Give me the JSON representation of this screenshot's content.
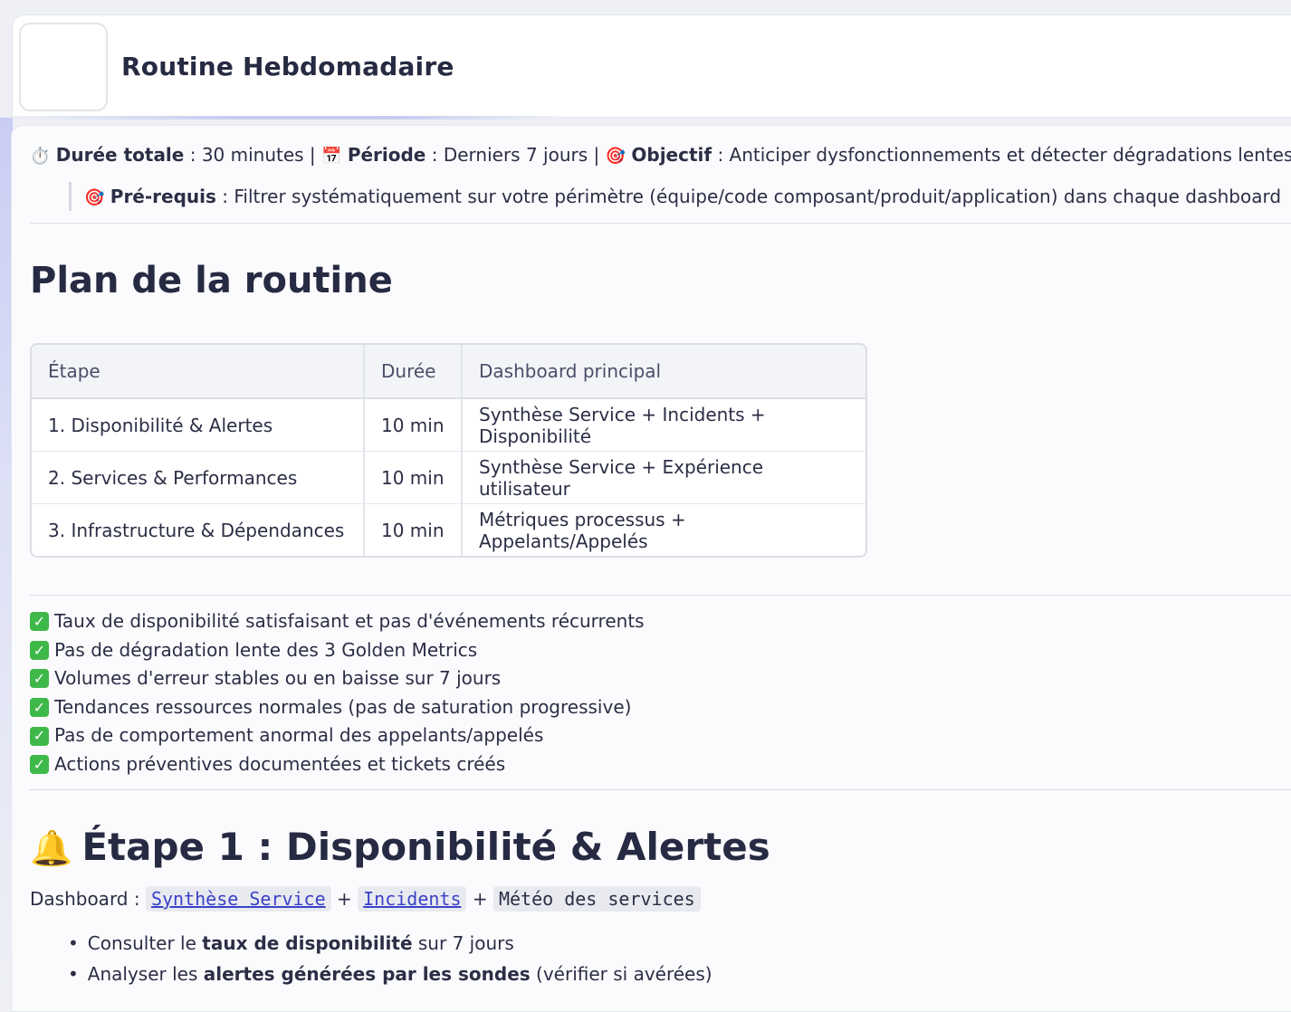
{
  "app": {
    "title": "Routine Hebdomadaire"
  },
  "meta": {
    "duration_label": "Durée totale",
    "duration_value": " : 30 minutes | ",
    "period_label": "Période",
    "period_value": " : Derniers 7 jours | ",
    "objective_label": "Objectif",
    "objective_value": " : Anticiper dysfonctionnements et détecter dégradations lentes",
    "icons": [
      "stopwatch-icon",
      "calendar-icon",
      "target-icon"
    ]
  },
  "prereq": {
    "label": "Pré-requis",
    "value": " : Filtrer systématiquement sur votre périmètre (équipe/code composant/produit/application) dans chaque dashboard"
  },
  "plan": {
    "heading": "Plan de la routine",
    "columns": [
      "Étape",
      "Durée",
      "Dashboard principal"
    ],
    "rows": [
      [
        "1. Disponibilité & Alertes",
        "10 min",
        "Synthèse Service + Incidents + Disponibilité"
      ],
      [
        "2. Services & Performances",
        "10 min",
        "Synthèse Service + Expérience utilisateur"
      ],
      [
        "3. Infrastructure & Dépendances",
        "10 min",
        "Métriques processus + Appelants/Appelés"
      ]
    ]
  },
  "checklist": [
    "Taux de disponibilité satisfaisant et pas d'événements récurrents",
    "Pas de dégradation lente des 3 Golden Metrics",
    "Volumes d'erreur stables ou en baisse sur 7 jours",
    "Tendances ressources normales (pas de saturation progressive)",
    "Pas de comportement anormal des appelants/appelés",
    "Actions préventives documentées et tickets créés"
  ],
  "step1": {
    "heading": "Étape 1 : Disponibilité & Alertes",
    "dashboard_label": "Dashboard",
    "dashboard_sep": " : ",
    "links": [
      "Synthèse Service",
      "Incidents"
    ],
    "plain_code": "Météo des services",
    "bullets": [
      {
        "pre": "Consulter le ",
        "bold": "taux de disponibilité",
        "post": " sur 7 jours"
      },
      {
        "pre": "Analyser les ",
        "bold": "alertes générées par les sondes",
        "post": " (vérifier si avérées)"
      }
    ]
  },
  "colors": {
    "check_green": "#3fb84a",
    "link": "#3a42c8",
    "accent_glow": "#c5cbef"
  }
}
